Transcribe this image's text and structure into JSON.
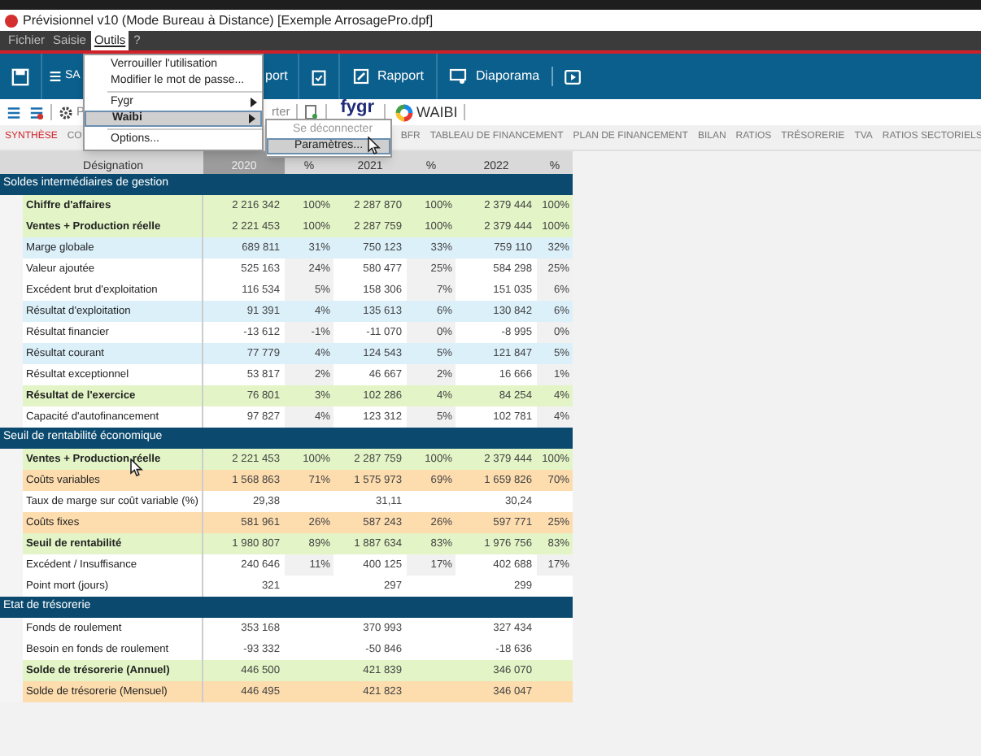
{
  "window": {
    "title": "Prévisionnel v10 (Mode Bureau à Distance) [Exemple ArrosagePro.dpf]"
  },
  "menu_bar": [
    {
      "label": "Fichier",
      "selected": false
    },
    {
      "label": "Saisie",
      "selected": false
    },
    {
      "label": "Outils",
      "selected": true
    },
    {
      "label": "?",
      "selected": false
    }
  ],
  "dropdown": {
    "items": [
      {
        "kind": "item",
        "label": "Verrouiller l'utilisation",
        "selected": false
      },
      {
        "kind": "item",
        "label": "Modifier le mot de passe...",
        "selected": false
      },
      {
        "kind": "separator"
      },
      {
        "kind": "submenu",
        "label": "Fygr",
        "selected": false
      },
      {
        "kind": "submenu",
        "label": "Waibi",
        "selected": true
      },
      {
        "kind": "separator"
      },
      {
        "kind": "item",
        "label": "Options...",
        "selected": false
      }
    ],
    "submenu": [
      {
        "label": "Se déconnecter",
        "disabled": true,
        "selected": false
      },
      {
        "label": "Paramètres...",
        "disabled": false,
        "selected": true
      }
    ]
  },
  "toolbar": {
    "save_label": "SA",
    "import_label": "port",
    "report_label": "Rapport",
    "slideshow_label": "Diaporama"
  },
  "toolbar2": {
    "partial_label_1": "P",
    "partial_label_2": "rter",
    "fygr_logo": "fygr",
    "waibi_logo": "WAIBI"
  },
  "tabs": [
    {
      "label": "SYNTHÈSE",
      "selected": true
    },
    {
      "label": "CO",
      "selected": false
    },
    {
      "label": "BFR",
      "selected": false
    },
    {
      "label": "TABLEAU DE FINANCEMENT",
      "selected": false
    },
    {
      "label": "PLAN DE FINANCEMENT",
      "selected": false
    },
    {
      "label": "BILAN",
      "selected": false
    },
    {
      "label": "RATIOS",
      "selected": false
    },
    {
      "label": "TRÉSORERIE",
      "selected": false
    },
    {
      "label": "TVA",
      "selected": false
    },
    {
      "label": "RATIOS SECTORIELS",
      "selected": false
    }
  ],
  "table": {
    "columns": [
      "Désignation",
      "2020",
      "%",
      "2021",
      "%",
      "2022",
      "%"
    ],
    "sections": [
      {
        "title": "Soldes intermédiaires de gestion",
        "rows": [
          {
            "kind": "total",
            "label": "Chiffre d'affaires",
            "values": [
              {
                "amount": "2 216 342",
                "pct": "100%"
              },
              {
                "amount": "2 287 870",
                "pct": "100%"
              },
              {
                "amount": "2 379 444",
                "pct": "100%"
              }
            ]
          },
          {
            "kind": "total",
            "label": "Ventes + Production réelle",
            "values": [
              {
                "amount": "2 221 453",
                "pct": "100%"
              },
              {
                "amount": "2 287 759",
                "pct": "100%"
              },
              {
                "amount": "2 379 444",
                "pct": "100%"
              }
            ]
          },
          {
            "kind": "margin",
            "label": "Marge globale",
            "values": [
              {
                "amount": "689 811",
                "pct": "31%"
              },
              {
                "amount": "750 123",
                "pct": "33%"
              },
              {
                "amount": "759 110",
                "pct": "32%"
              }
            ]
          },
          {
            "kind": "plain",
            "label": "Valeur ajoutée",
            "values": [
              {
                "amount": "525 163",
                "pct": "24%"
              },
              {
                "amount": "580 477",
                "pct": "25%"
              },
              {
                "amount": "584 298",
                "pct": "25%"
              }
            ]
          },
          {
            "kind": "plain",
            "label": "Excédent brut d'exploitation",
            "values": [
              {
                "amount": "116 534",
                "pct": "5%"
              },
              {
                "amount": "158 306",
                "pct": "7%"
              },
              {
                "amount": "151 035",
                "pct": "6%"
              }
            ]
          },
          {
            "kind": "margin",
            "label": "Résultat d'exploitation",
            "values": [
              {
                "amount": "91 391",
                "pct": "4%"
              },
              {
                "amount": "135 613",
                "pct": "6%"
              },
              {
                "amount": "130 842",
                "pct": "6%"
              }
            ]
          },
          {
            "kind": "plain",
            "label": "Résultat financier",
            "values": [
              {
                "amount": "-13 612",
                "pct": "-1%"
              },
              {
                "amount": "-11 070",
                "pct": "0%"
              },
              {
                "amount": "-8 995",
                "pct": "0%"
              }
            ]
          },
          {
            "kind": "margin",
            "label": "Résultat courant",
            "values": [
              {
                "amount": "77 779",
                "pct": "4%"
              },
              {
                "amount": "124 543",
                "pct": "5%"
              },
              {
                "amount": "121 847",
                "pct": "5%"
              }
            ]
          },
          {
            "kind": "plain",
            "label": "Résultat exceptionnel",
            "values": [
              {
                "amount": "53 817",
                "pct": "2%"
              },
              {
                "amount": "46 667",
                "pct": "2%"
              },
              {
                "amount": "16 666",
                "pct": "1%"
              }
            ]
          },
          {
            "kind": "total",
            "label": "Résultat de l'exercice",
            "values": [
              {
                "amount": "76 801",
                "pct": "3%"
              },
              {
                "amount": "102 286",
                "pct": "4%"
              },
              {
                "amount": "84 254",
                "pct": "4%"
              }
            ]
          },
          {
            "kind": "plain",
            "label": "Capacité d'autofinancement",
            "values": [
              {
                "amount": "97 827",
                "pct": "4%"
              },
              {
                "amount": "123 312",
                "pct": "5%"
              },
              {
                "amount": "102 781",
                "pct": "4%"
              }
            ]
          }
        ]
      },
      {
        "title": "Seuil de rentabilité économique",
        "rows": [
          {
            "kind": "total",
            "label": "Ventes + Production réelle",
            "values": [
              {
                "amount": "2 221 453",
                "pct": "100%"
              },
              {
                "amount": "2 287 759",
                "pct": "100%"
              },
              {
                "amount": "2 379 444",
                "pct": "100%"
              }
            ]
          },
          {
            "kind": "cost",
            "label": "Coûts variables",
            "values": [
              {
                "amount": "1 568 863",
                "pct": "71%"
              },
              {
                "amount": "1 575 973",
                "pct": "69%"
              },
              {
                "amount": "1 659 826",
                "pct": "70%"
              }
            ]
          },
          {
            "kind": "plain",
            "label": "Taux de marge sur coût variable (%)",
            "values": [
              {
                "amount": "29,38"
              },
              {
                "amount": "31,11"
              },
              {
                "amount": "30,24"
              }
            ]
          },
          {
            "kind": "cost",
            "label": "Coûts fixes",
            "values": [
              {
                "amount": "581 961",
                "pct": "26%"
              },
              {
                "amount": "587 243",
                "pct": "26%"
              },
              {
                "amount": "597 771",
                "pct": "25%"
              }
            ]
          },
          {
            "kind": "total",
            "label": "Seuil de rentabilité",
            "values": [
              {
                "amount": "1 980 807",
                "pct": "89%"
              },
              {
                "amount": "1 887 634",
                "pct": "83%"
              },
              {
                "amount": "1 976 756",
                "pct": "83%"
              }
            ]
          },
          {
            "kind": "plain",
            "label": "Excédent / Insuffisance",
            "values": [
              {
                "amount": "240 646",
                "pct": "11%"
              },
              {
                "amount": "400 125",
                "pct": "17%"
              },
              {
                "amount": "402 688",
                "pct": "17%"
              }
            ]
          },
          {
            "kind": "plain",
            "label": "Point mort (jours)",
            "values": [
              {
                "amount": "321"
              },
              {
                "amount": "297"
              },
              {
                "amount": "299"
              }
            ]
          }
        ]
      },
      {
        "title": "Etat de trésorerie",
        "rows": [
          {
            "kind": "plain",
            "label": "Fonds de roulement",
            "values": [
              {
                "amount": "353 168"
              },
              {
                "amount": "370 993"
              },
              {
                "amount": "327 434"
              }
            ]
          },
          {
            "kind": "plain",
            "label": "Besoin en fonds de roulement",
            "values": [
              {
                "amount": "-93 332"
              },
              {
                "amount": "-50 846"
              },
              {
                "amount": "-18 636"
              }
            ]
          },
          {
            "kind": "total",
            "label": "Solde de trésorerie (Annuel)",
            "values": [
              {
                "amount": "446 500"
              },
              {
                "amount": "421 839"
              },
              {
                "amount": "346 070"
              }
            ]
          },
          {
            "kind": "cost",
            "label": "Solde de trésorerie (Mensuel)",
            "values": [
              {
                "amount": "446 495"
              },
              {
                "amount": "421 823"
              },
              {
                "amount": "346 047"
              }
            ]
          }
        ]
      }
    ]
  }
}
